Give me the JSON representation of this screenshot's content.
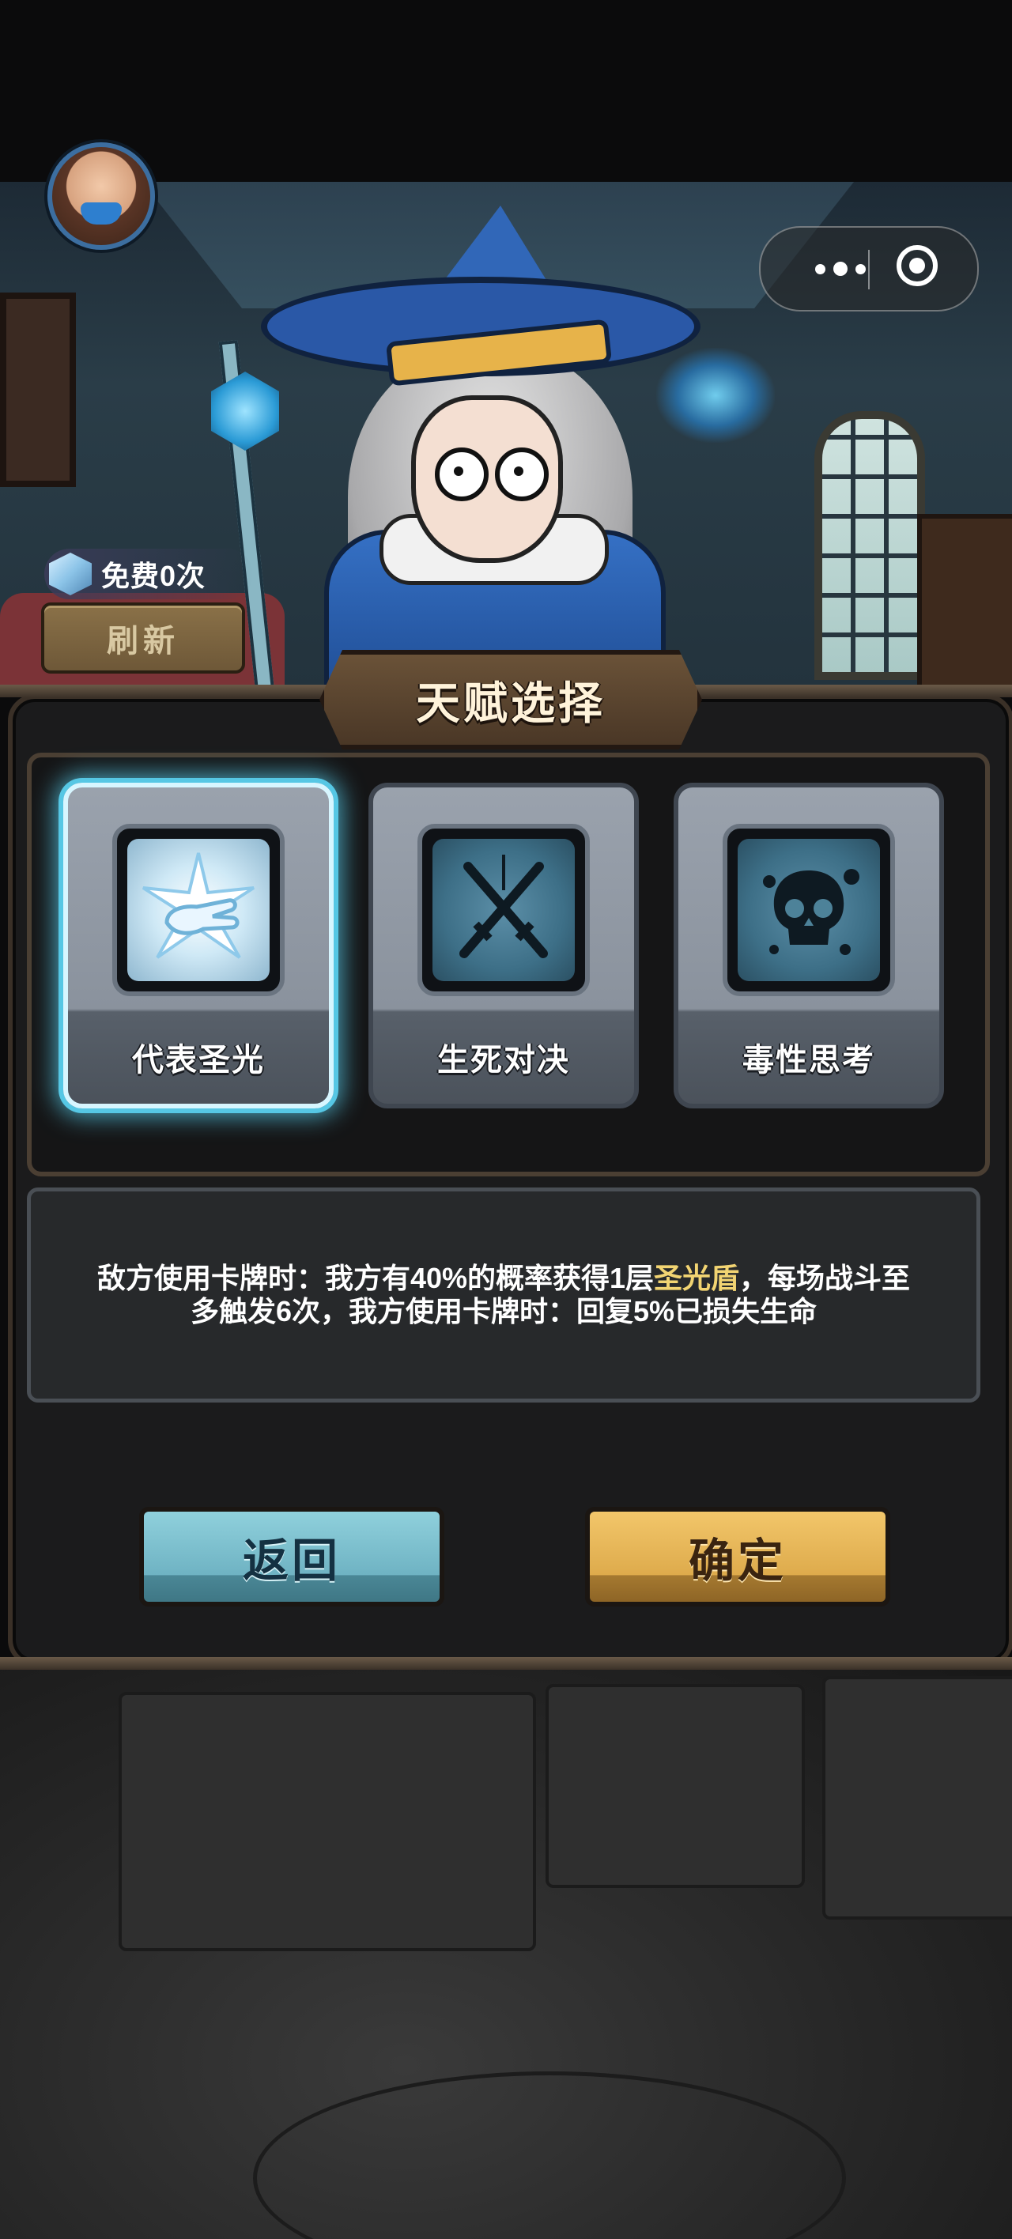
{
  "hud": {
    "avatar_icon": "player-avatar",
    "menu_icon": "more-dots-icon",
    "close_icon": "target-close-icon"
  },
  "refresh": {
    "free_text": "免费0次",
    "button_label": "刷新",
    "icon": "crystal-cube-icon"
  },
  "panel": {
    "title": "天赋选择",
    "talents": [
      {
        "name": "代表圣光",
        "icon": "holy-hand-icon",
        "selected": true
      },
      {
        "name": "生死对决",
        "icon": "crossed-swords-icon",
        "selected": false
      },
      {
        "name": "毒性思考",
        "icon": "poison-skull-icon",
        "selected": false
      }
    ],
    "description": {
      "part1": "敌方使用卡牌时：我方有40%的概率获得1层",
      "highlight": "圣光盾",
      "part2": "，每场战斗至多触发6次，我方使用卡牌时：回复5%已损失生命"
    },
    "buttons": {
      "back": "返回",
      "confirm": "确定"
    }
  },
  "colors": {
    "highlight": "#f2d472",
    "selected_glow": "#56c7e4",
    "back_button": "#7cc1cf",
    "confirm_button": "#e6b659"
  }
}
